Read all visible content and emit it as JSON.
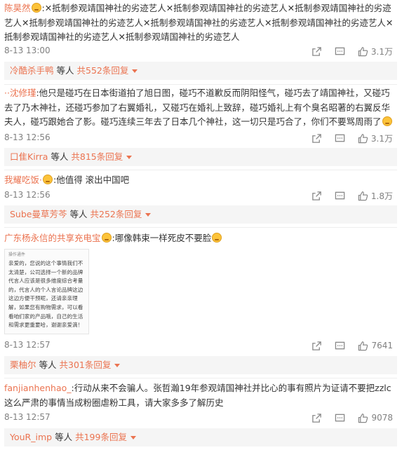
{
  "comments": [
    {
      "user": "陈昊然",
      "text": ":✕抵制参观靖国神社的劣迹艺人✕抵制参观靖国神社的劣迹艺人✕抵制参观靖国神社的劣迹艺人✕抵制参观靖国神社的劣迹艺人✕抵制参观靖国神社的劣迹艺人✕抵制参观靖国神社的劣迹艺人✕抵制参观靖国神社的劣迹艺人✕抵制参观靖国神社的劣迹艺人",
      "time": "8-13 13:00",
      "likes": "3.1万",
      "reply_user": "冷酷杀手鸭",
      "reply_mid": "等人",
      "reply_count": "共552条回复"
    },
    {
      "user": "··沈修瑾",
      "text": ":他只是碰巧在日本街道拍了旭日图，碰巧不道歉反而阴阳怪气，碰巧去了靖国神社，又碰巧去了乃木神社，还碰巧参加了右翼婚礼，又碰巧在婚礼上致辞，碰巧婚礼上有个臭名昭著的右翼反华夫人，碰巧跟她合了影。碰巧连续三年去了日本几个神社，这一切只是巧合了，你们不要骂周雨了",
      "time": "8-13 12:56",
      "likes": "3.1万",
      "reply_user": "口隹Kirra",
      "reply_mid": "等人",
      "reply_count": "共815条回复"
    },
    {
      "user": "我耀吃饭·",
      "text": ":他值得 滚出中国吧",
      "time": "8-13 12:56",
      "likes": "1.8万",
      "reply_user": "Sube曼草芳芩",
      "reply_mid": "等人",
      "reply_count": "共252条回复"
    },
    {
      "user": "广东杨永信的共享充电宝",
      "text": ":哪像韩束一样死皮不要脸",
      "screenshot_header": "操作通件",
      "screenshot_text": "亲爱的，您说的这个事情我们不太清楚，公司选择一个新的品牌代言人应该是很多维度综合考量的，代言人的个人言论品牌这边这边方便干预呢，还请亲亲理解，如果您有购物需求，可以看看咱们家的产品哦，自己的生活和需求更重要哈，谢谢亲爱滴！",
      "time": "8-13 12:57",
      "likes": "7641",
      "reply_user": "栗柚尔",
      "reply_mid": "等人",
      "reply_count": "共301条回复"
    },
    {
      "user": "fanjianhenhao_",
      "text": ":行动从来不会骗人。张哲瀚19年参观靖国神社并比心的事有照片为证请不要把zzlc这么严肃的事情当成粉圈虐粉工具，请大家多多了解历史",
      "time": "8-13 12:57",
      "likes": "9078",
      "reply_user": "YouR_imp",
      "reply_mid": "等人",
      "reply_count": "共199条回复"
    }
  ],
  "colors": {
    "username": "#eb7350",
    "reply_bg": "#f5f5f5",
    "meta": "#808080"
  },
  "icons": [
    "share-icon",
    "comment-icon",
    "like-icon",
    "caret-down-icon",
    "emoji-icon"
  ]
}
